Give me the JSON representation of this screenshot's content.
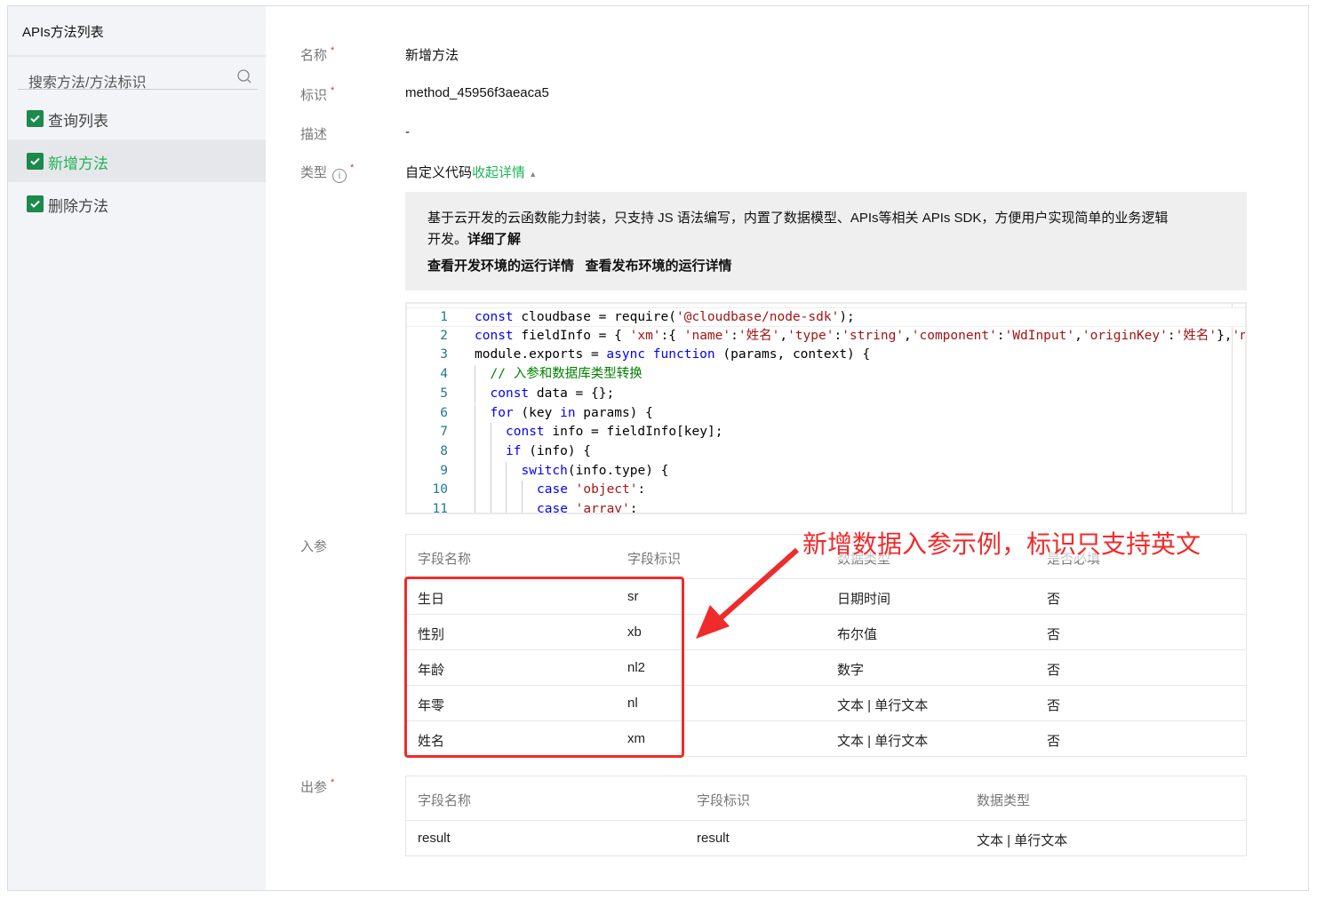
{
  "sidebar": {
    "title": "APIs方法列表",
    "search_placeholder": "搜索方法/方法标识",
    "items": [
      {
        "label": "查询列表",
        "checked": true
      },
      {
        "label": "新增方法",
        "checked": true,
        "active": true
      },
      {
        "label": "删除方法",
        "checked": true
      }
    ]
  },
  "form": {
    "name_label": "名称",
    "name_value": "新增方法",
    "id_label": "标识",
    "id_value": "method_45956f3aeaca5",
    "desc_label": "描述",
    "desc_value": "-",
    "type_label": "类型",
    "type_value": "自定义代码",
    "type_toggle": "收起详情",
    "type_desc_line1": "基于云开发的云函数能力封装，只支持 JS 语法编写，内置了数据模型、APIs等相关 APIs SDK，方便用户实现简单的业务逻辑",
    "type_desc_line2_prefix": "开发。",
    "type_desc_link": "详细了解",
    "dev_env_link": "查看开发环境的运行详情",
    "prod_env_link": "查看发布环境的运行详情",
    "in_label": "入参",
    "out_label": "出参"
  },
  "code": [
    {
      "n": "1",
      "indent": 0,
      "tokens": [
        [
          "kw",
          "const"
        ],
        [
          "pl",
          " cloudbase = require("
        ],
        [
          "str",
          "'@cloudbase/node-sdk'"
        ],
        [
          "pl",
          ");"
        ]
      ]
    },
    {
      "n": "2",
      "indent": 0,
      "tokens": [
        [
          "kw",
          "const"
        ],
        [
          "pl",
          " fieldInfo = { "
        ],
        [
          "str",
          "'xm'"
        ],
        [
          "pl",
          ":{ "
        ],
        [
          "str",
          "'name'"
        ],
        [
          "pl",
          ":"
        ],
        [
          "str",
          "'姓名'"
        ],
        [
          "pl",
          ","
        ],
        [
          "str",
          "'type'"
        ],
        [
          "pl",
          ":"
        ],
        [
          "str",
          "'string'"
        ],
        [
          "pl",
          ","
        ],
        [
          "str",
          "'component'"
        ],
        [
          "pl",
          ":"
        ],
        [
          "str",
          "'WdInput'"
        ],
        [
          "pl",
          ","
        ],
        [
          "str",
          "'originKey'"
        ],
        [
          "pl",
          ":"
        ],
        [
          "str",
          "'姓名'"
        ],
        [
          "pl",
          "},"
        ],
        [
          "str",
          "'n"
        ]
      ]
    },
    {
      "n": "3",
      "indent": 0,
      "tokens": [
        [
          "pl",
          "module.exports = "
        ],
        [
          "kw",
          "async"
        ],
        [
          "pl",
          " "
        ],
        [
          "kw",
          "function"
        ],
        [
          "pl",
          " (params, context) {"
        ]
      ]
    },
    {
      "n": "4",
      "indent": 1,
      "tokens": [
        [
          "cm",
          "// 入参和数据库类型转换"
        ]
      ]
    },
    {
      "n": "5",
      "indent": 1,
      "tokens": [
        [
          "kw",
          "const"
        ],
        [
          "pl",
          " data = {};"
        ]
      ]
    },
    {
      "n": "6",
      "indent": 1,
      "tokens": [
        [
          "kw",
          "for"
        ],
        [
          "pl",
          " (key "
        ],
        [
          "kw",
          "in"
        ],
        [
          "pl",
          " params) {"
        ]
      ]
    },
    {
      "n": "7",
      "indent": 2,
      "tokens": [
        [
          "kw",
          "const"
        ],
        [
          "pl",
          " info = fieldInfo[key];"
        ]
      ]
    },
    {
      "n": "8",
      "indent": 2,
      "tokens": [
        [
          "kw",
          "if"
        ],
        [
          "pl",
          " (info) {"
        ]
      ]
    },
    {
      "n": "9",
      "indent": 3,
      "tokens": [
        [
          "kw",
          "switch"
        ],
        [
          "pl",
          "(info.type) {"
        ]
      ]
    },
    {
      "n": "10",
      "indent": 4,
      "tokens": [
        [
          "kw",
          "case"
        ],
        [
          "pl",
          " "
        ],
        [
          "str",
          "'object'"
        ],
        [
          "pl",
          ":"
        ]
      ]
    },
    {
      "n": "11",
      "indent": 4,
      "tokens": [
        [
          "kw",
          "case"
        ],
        [
          "pl",
          " "
        ],
        [
          "str",
          "'array'"
        ],
        [
          "pl",
          ":"
        ]
      ]
    }
  ],
  "in_table": {
    "headers": [
      "字段名称",
      "字段标识",
      "数据类型",
      "是否必填"
    ],
    "rows": [
      [
        "生日",
        "sr",
        "日期时间",
        "否"
      ],
      [
        "性别",
        "xb",
        "布尔值",
        "否"
      ],
      [
        "年龄",
        "nl2",
        "数字",
        "否"
      ],
      [
        "年零",
        "nl",
        "文本 | 单行文本",
        "否"
      ],
      [
        "姓名",
        "xm",
        "文本 | 单行文本",
        "否"
      ]
    ]
  },
  "out_table": {
    "headers": [
      "字段名称",
      "字段标识",
      "数据类型"
    ],
    "rows": [
      [
        "result",
        "result",
        "文本 | 单行文本"
      ]
    ]
  },
  "annotation": {
    "text": "新增数据入参示例，标识只支持英文",
    "color": "#f02b2b"
  },
  "colors": {
    "accent": "#1fb35a",
    "checkbox": "#1b8a4c",
    "required": "#e5352b"
  }
}
